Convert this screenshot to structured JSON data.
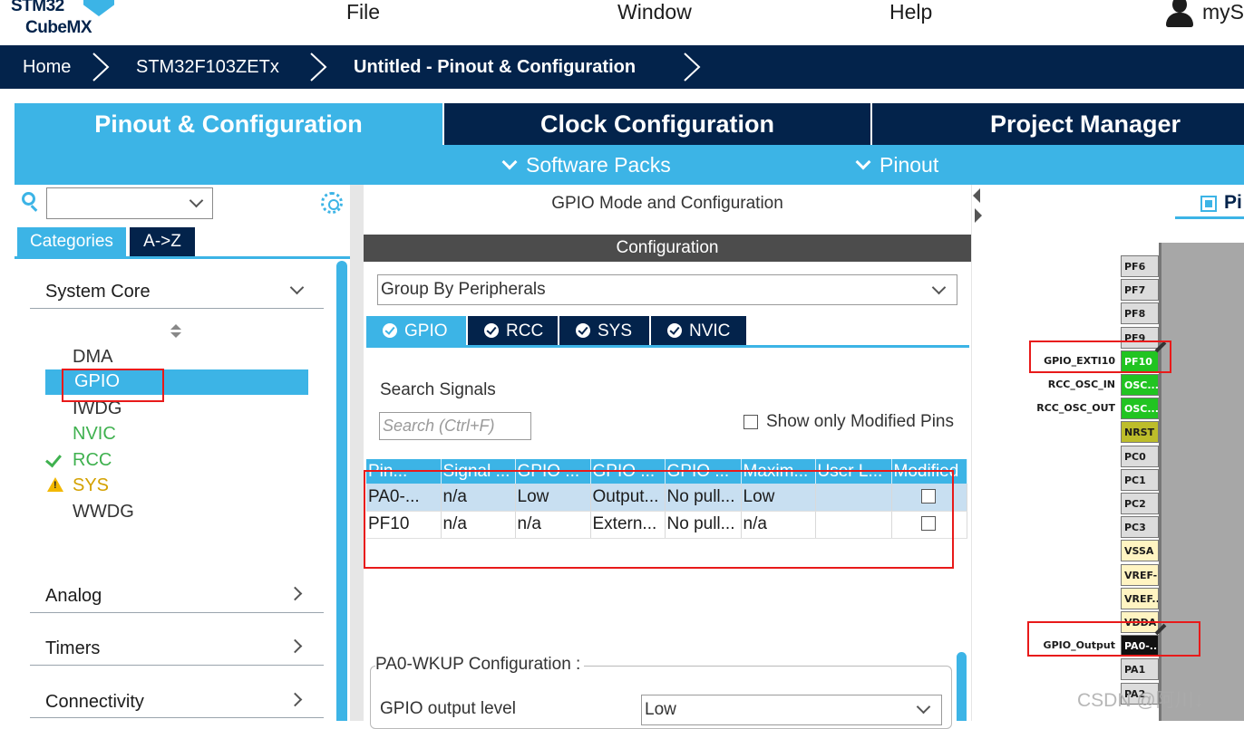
{
  "app": {
    "logo_line1": "STM32",
    "logo_line2": "CubeMX",
    "user_name": "myS"
  },
  "menu": {
    "items": [
      "File",
      "Window",
      "Help"
    ]
  },
  "breadcrumb": {
    "items": [
      "Home",
      "STM32F103ZETx",
      "Untitled - Pinout & Configuration"
    ]
  },
  "main_tabs": {
    "items": [
      {
        "label": "Pinout & Configuration",
        "active": true
      },
      {
        "label": "Clock Configuration",
        "active": false
      },
      {
        "label": "Project Manager",
        "active": false
      }
    ]
  },
  "sub_menu": {
    "software_packs": "Software Packs",
    "pinout": "Pinout"
  },
  "left_panel": {
    "search_value": "",
    "category_tabs": [
      "Categories",
      "A->Z"
    ],
    "sections": [
      "System Core",
      "Analog",
      "Timers",
      "Connectivity"
    ],
    "system_core_items": [
      {
        "label": "DMA",
        "status": "none"
      },
      {
        "label": "GPIO",
        "status": "selected"
      },
      {
        "label": "IWDG",
        "status": "none"
      },
      {
        "label": "NVIC",
        "status": "ok"
      },
      {
        "label": "RCC",
        "status": "checked"
      },
      {
        "label": "SYS",
        "status": "warning"
      },
      {
        "label": "WWDG",
        "status": "none"
      }
    ]
  },
  "mid_panel": {
    "title": "GPIO Mode and Configuration",
    "config_header": "Configuration",
    "group_by": "Group By Peripherals",
    "peripheral_tabs": [
      {
        "label": "GPIO",
        "active": true
      },
      {
        "label": "RCC",
        "active": false
      },
      {
        "label": "SYS",
        "active": false
      },
      {
        "label": "NVIC",
        "active": false
      }
    ],
    "search_signals_label": "Search Signals",
    "search_placeholder": "Search (Ctrl+F)",
    "show_modified_label": "Show only Modified Pins",
    "table": {
      "headers": [
        "Pin...",
        "Signal ...",
        "GPIO ...",
        "GPIO ...",
        "GPIO ...",
        "Maxim...",
        "User L...",
        "Modified"
      ],
      "rows": [
        [
          "PA0-...",
          "n/a",
          "Low",
          "Output...",
          "No pull...",
          "Low",
          "",
          ""
        ],
        [
          "PF10",
          "n/a",
          "n/a",
          "Extern...",
          "No pull...",
          "n/a",
          "",
          ""
        ]
      ]
    },
    "pin_config_title": "PA0-WKUP Configuration :",
    "output_level_label": "GPIO output level",
    "output_level_value": "Low"
  },
  "pinout_view": {
    "tab_label": "Pi",
    "pins": [
      {
        "name": "PF6",
        "color": "default",
        "label": ""
      },
      {
        "name": "PF7",
        "color": "default",
        "label": ""
      },
      {
        "name": "PF8",
        "color": "default",
        "label": ""
      },
      {
        "name": "PF9",
        "color": "default",
        "label": ""
      },
      {
        "name": "PF10",
        "color": "green",
        "label": "GPIO_EXTI10"
      },
      {
        "name": "OSC...",
        "color": "green",
        "label": "RCC_OSC_IN"
      },
      {
        "name": "OSC...",
        "color": "green",
        "label": "RCC_OSC_OUT"
      },
      {
        "name": "NRST",
        "color": "olive",
        "label": ""
      },
      {
        "name": "PC0",
        "color": "default",
        "label": ""
      },
      {
        "name": "PC1",
        "color": "default",
        "label": ""
      },
      {
        "name": "PC2",
        "color": "default",
        "label": ""
      },
      {
        "name": "PC3",
        "color": "default",
        "label": ""
      },
      {
        "name": "VSSA",
        "color": "cream",
        "label": ""
      },
      {
        "name": "VREF-",
        "color": "cream",
        "label": ""
      },
      {
        "name": "VREF..",
        "color": "cream",
        "label": ""
      },
      {
        "name": "VDDA",
        "color": "cream",
        "label": ""
      },
      {
        "name": "PA0-..",
        "color": "black",
        "label": "GPIO_Output"
      },
      {
        "name": "PA1",
        "color": "default",
        "label": ""
      },
      {
        "name": "PA2",
        "color": "default",
        "label": ""
      }
    ]
  },
  "watermark": "CSDN @阿川↓",
  "colors": {
    "navy": "#03234b",
    "accent": "#3cb4e6",
    "pin_green": "#21c421",
    "highlight_red": "#e81a1a"
  }
}
